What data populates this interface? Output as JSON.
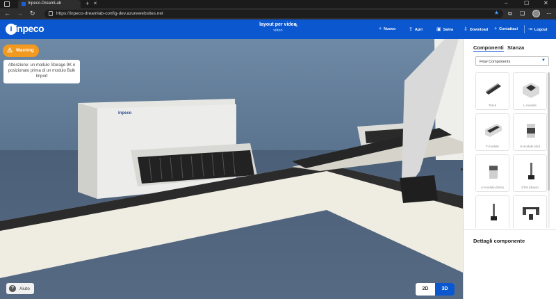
{
  "browser": {
    "tab_title": "Inpeco-DreamLab",
    "url": "https://inpeco-dreamlab-config-dev.azurewebsites.net"
  },
  "header": {
    "logo_text": "inpeco",
    "project_title": "layout per video",
    "project_subtitle": "video",
    "menu": {
      "new": "Nuovo",
      "open": "Apri",
      "save": "Salva",
      "download": "Download",
      "contacts": "Contattaci",
      "logout": "Logout"
    }
  },
  "viewport": {
    "warning_label": "Warning",
    "warning_message": "Attenzione: un modulo Storage 9K è posizionato prima di un modulo Bulk Import",
    "storage_brand": "inpeco",
    "help_label": "Aiuto",
    "view_2d": "2D",
    "view_3d": "3D",
    "active_view": "3D"
  },
  "panel": {
    "tab_components": "Componenti",
    "tab_room": "Stanza",
    "selected_category": "Flow Components",
    "components": [
      {
        "label": "Track"
      },
      {
        "label": "L-module"
      },
      {
        "label": "T-module"
      },
      {
        "label": "U-module (slc)"
      },
      {
        "label": "U-module (bars)"
      },
      {
        "label": "STM (down)"
      },
      {
        "label": ""
      },
      {
        "label": ""
      }
    ],
    "details_title": "Dettagli componente"
  },
  "colors": {
    "brand_blue": "#0a57d0",
    "warning_orange": "#f29a1f"
  }
}
